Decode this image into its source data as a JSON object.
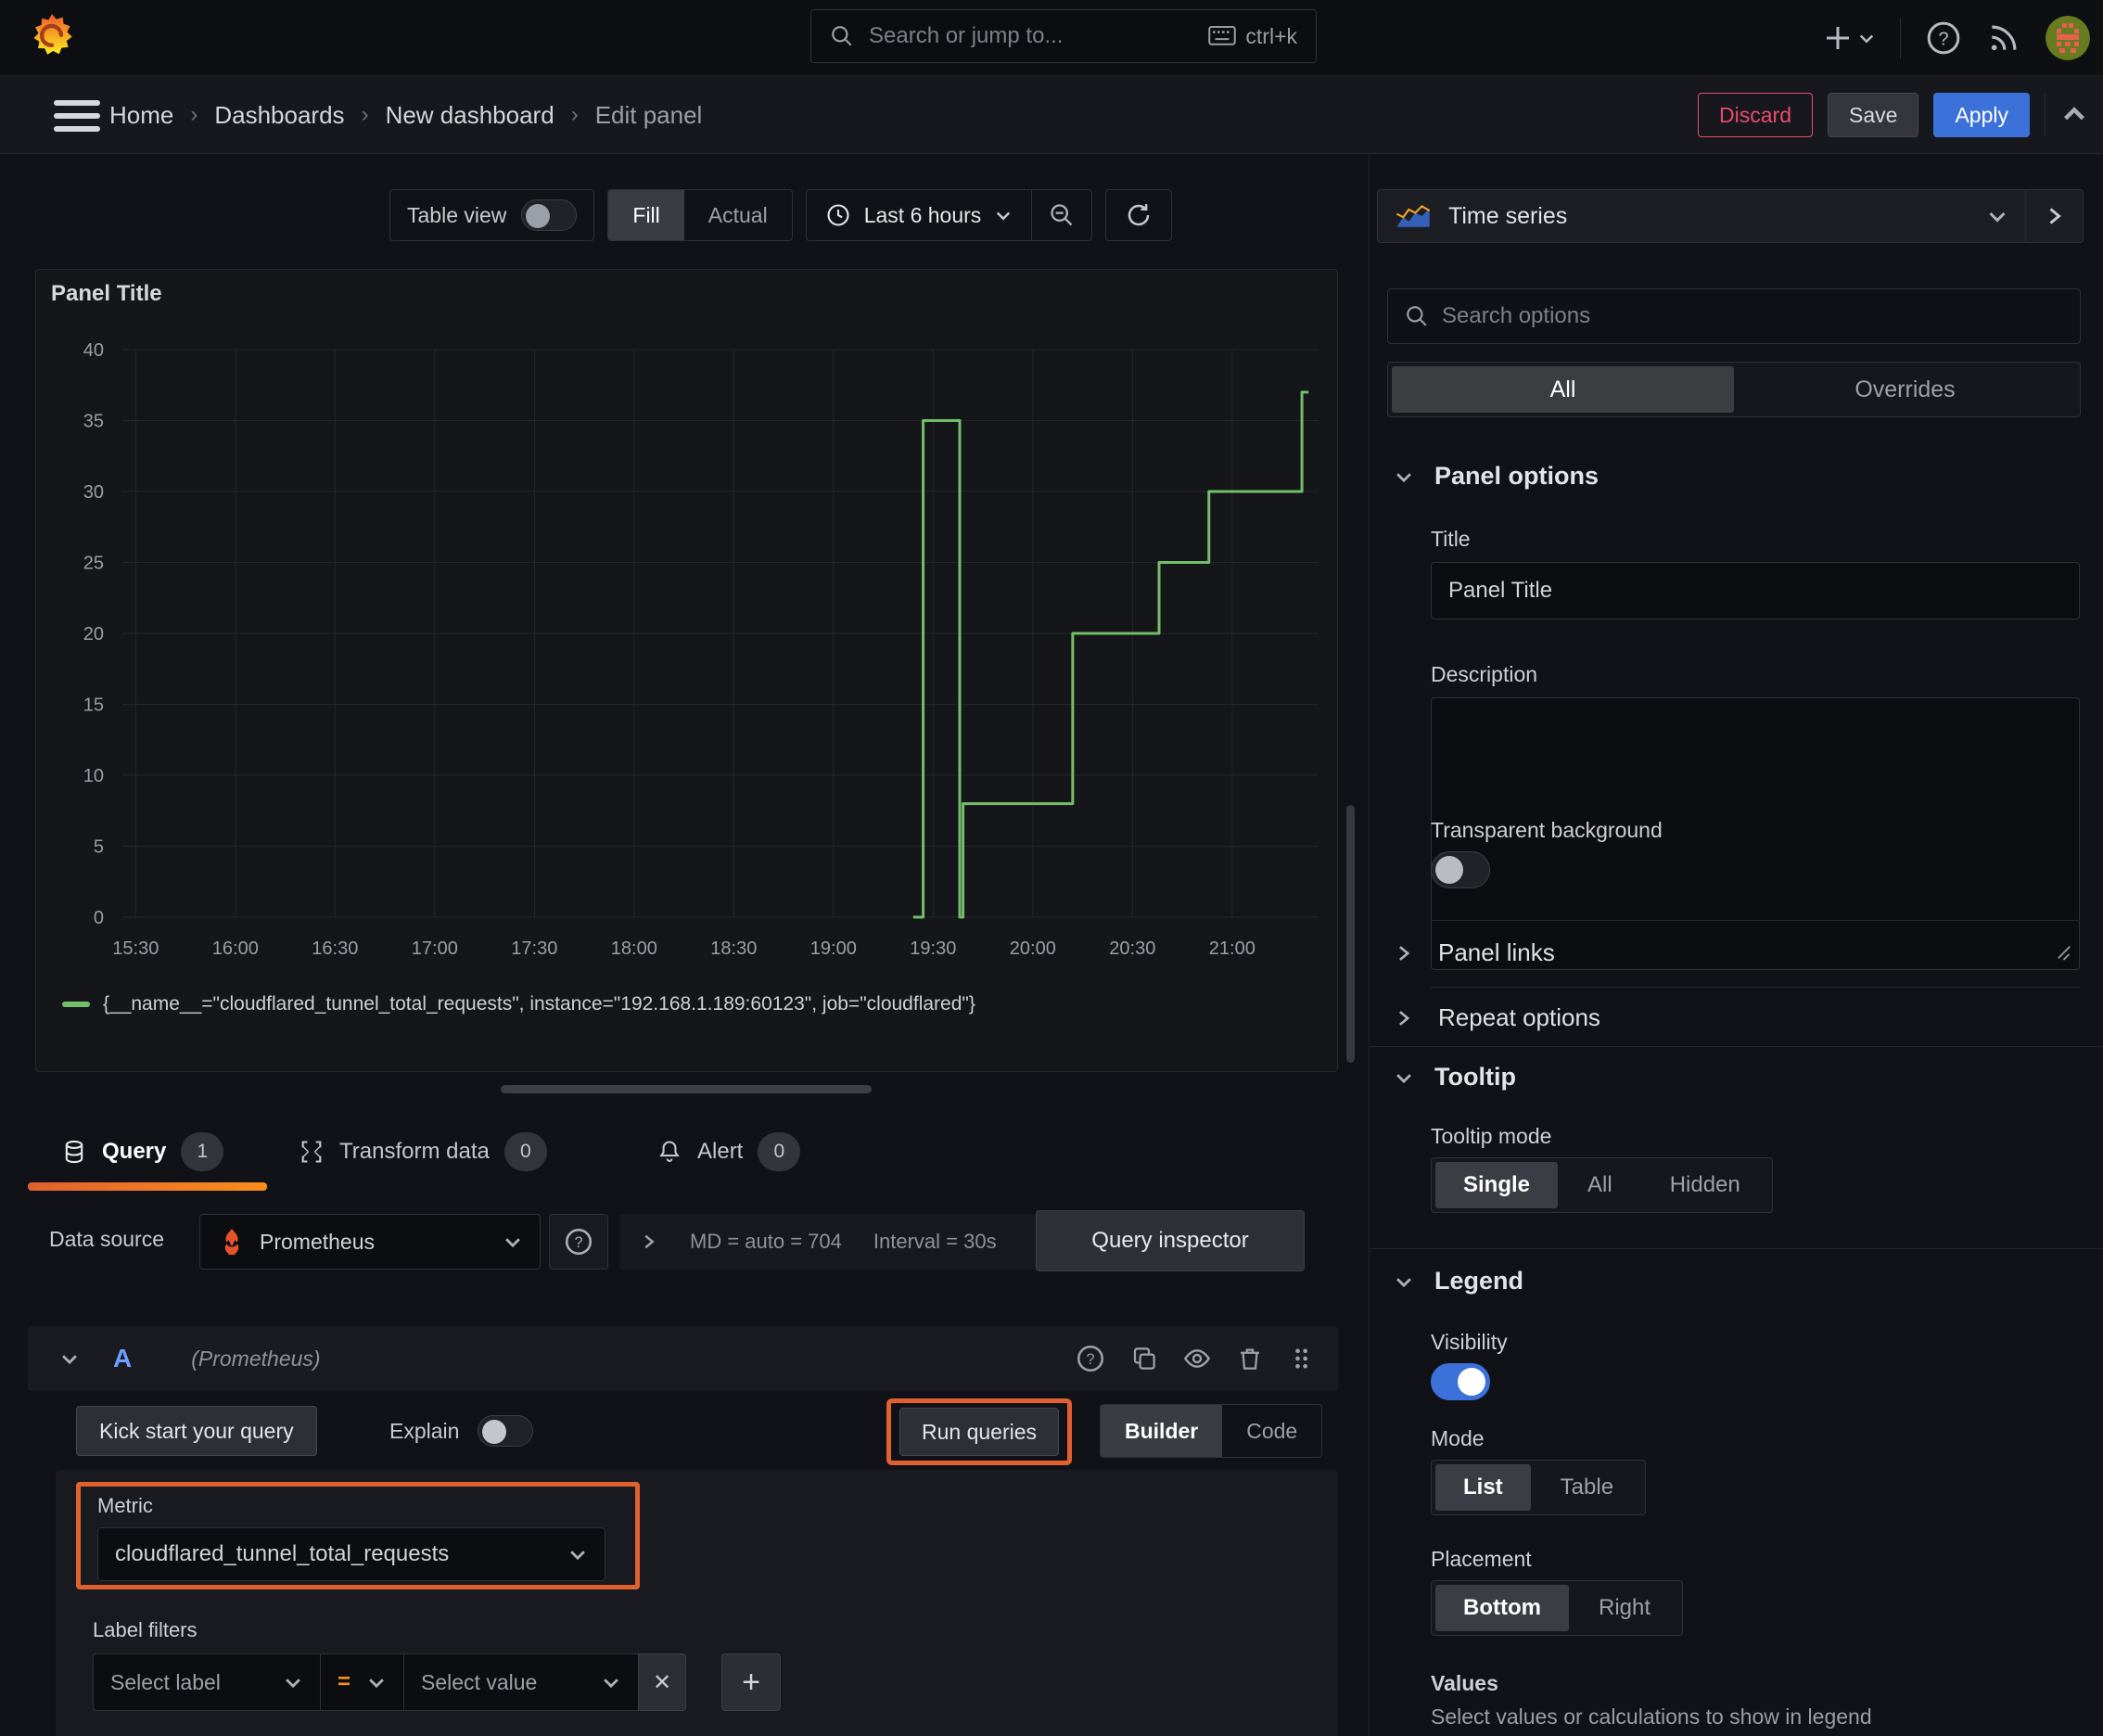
{
  "topbar": {
    "search_placeholder": "Search or jump to...",
    "search_shortcut": "ctrl+k"
  },
  "navbar": {
    "breadcrumbs": [
      "Home",
      "Dashboards",
      "New dashboard",
      "Edit panel"
    ],
    "discard": "Discard",
    "save": "Save",
    "apply": "Apply"
  },
  "toolbar": {
    "table_view": "Table view",
    "fill": "Fill",
    "actual": "Actual",
    "time_range": "Last 6 hours"
  },
  "viz_picker": {
    "label": "Time series"
  },
  "panel": {
    "title": "Panel Title",
    "legend_series": "{__name__=\"cloudflared_tunnel_total_requests\", instance=\"192.168.1.189:60123\", job=\"cloudflared\"}"
  },
  "chart_data": {
    "type": "line",
    "line_style": "step",
    "title": "",
    "xlabel": "",
    "ylabel": "",
    "color": "#73bf69",
    "legend_position": "bottom",
    "grid": true,
    "ylim": [
      0,
      40
    ],
    "xlim_minutes": [
      926,
      1286
    ],
    "y_ticks": [
      0,
      5,
      10,
      15,
      20,
      25,
      30,
      35,
      40
    ],
    "x_ticks": [
      {
        "m": 930,
        "label": "15:30"
      },
      {
        "m": 960,
        "label": "16:00"
      },
      {
        "m": 990,
        "label": "16:30"
      },
      {
        "m": 1020,
        "label": "17:00"
      },
      {
        "m": 1050,
        "label": "17:30"
      },
      {
        "m": 1080,
        "label": "18:00"
      },
      {
        "m": 1110,
        "label": "18:30"
      },
      {
        "m": 1140,
        "label": "19:00"
      },
      {
        "m": 1170,
        "label": "19:30"
      },
      {
        "m": 1200,
        "label": "20:00"
      },
      {
        "m": 1230,
        "label": "20:30"
      },
      {
        "m": 1260,
        "label": "21:00"
      }
    ],
    "series": [
      {
        "name": "{__name__=\"cloudflared_tunnel_total_requests\", instance=\"192.168.1.189:60123\", job=\"cloudflared\"}",
        "points": [
          [
            1164,
            0
          ],
          [
            1167,
            0
          ],
          [
            1167,
            35
          ],
          [
            1178,
            35
          ],
          [
            1178,
            0
          ],
          [
            1179,
            0
          ],
          [
            1179,
            8
          ],
          [
            1212,
            8
          ],
          [
            1212,
            20
          ],
          [
            1238,
            20
          ],
          [
            1238,
            25
          ],
          [
            1253,
            25
          ],
          [
            1253,
            30
          ],
          [
            1281,
            30
          ],
          [
            1281,
            37
          ],
          [
            1283,
            37
          ]
        ]
      }
    ]
  },
  "tabs": [
    {
      "label": "Query",
      "count": "1"
    },
    {
      "label": "Transform data",
      "count": "0"
    },
    {
      "label": "Alert",
      "count": "0"
    }
  ],
  "datasource": {
    "label": "Data source",
    "name": "Prometheus",
    "md_stat": "MD = auto = 704",
    "interval_stat": "Interval = 30s",
    "inspector": "Query inspector"
  },
  "query": {
    "ref_id": "A",
    "ds_hint": "(Prometheus)",
    "kick_start": "Kick start your query",
    "explain": "Explain",
    "run_queries": "Run queries",
    "builder": "Builder",
    "code": "Code",
    "metric_label": "Metric",
    "metric_value": "cloudflared_tunnel_total_requests",
    "label_filters": "Label filters",
    "select_label": "Select label",
    "operator": "=",
    "select_value": "Select value"
  },
  "options": {
    "search_placeholder": "Search options",
    "tab_all": "All",
    "tab_overrides": "Overrides",
    "panel_options": {
      "header": "Panel options",
      "title_label": "Title",
      "title_value": "Panel Title",
      "description_label": "Description",
      "transparent_label": "Transparent background"
    },
    "panel_links": "Panel links",
    "repeat_options": "Repeat options",
    "tooltip": {
      "header": "Tooltip",
      "mode_label": "Tooltip mode",
      "single": "Single",
      "all": "All",
      "hidden": "Hidden",
      "selected": "Single"
    },
    "legend": {
      "header": "Legend",
      "visibility_label": "Visibility",
      "mode_label": "Mode",
      "list": "List",
      "table": "Table",
      "selected_mode": "List",
      "placement_label": "Placement",
      "bottom": "Bottom",
      "right": "Right",
      "selected_placement": "Bottom",
      "values_label": "Values",
      "values_hint": "Select values or calculations to show in legend"
    }
  },
  "colors": {
    "bg_page": "#111217",
    "bg_topbar": "#0e0f13",
    "bg_navbar": "#17181d",
    "accent_orange": "#e0612f",
    "accent_orange2": "#fb8d1a",
    "green": "#73bf69",
    "blue": "#3c71d9",
    "blue_text": "#6e9fff",
    "pink": "#eb4a6e",
    "prometheus_orange": "#e6522c",
    "text_primary": "#d8d9dc"
  }
}
